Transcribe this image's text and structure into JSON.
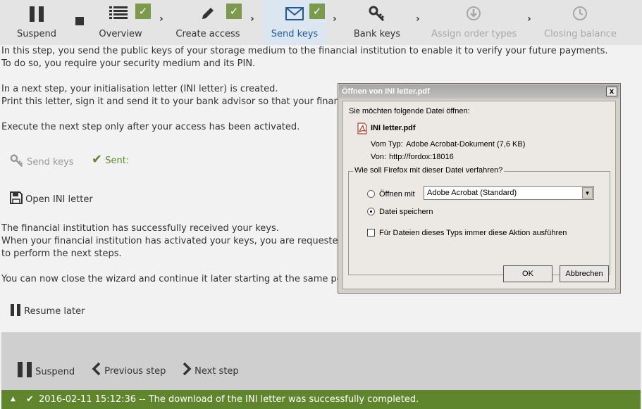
{
  "steps": [
    {
      "key": "suspend",
      "label": "Suspend",
      "icon": "pause-icon",
      "state": "normal"
    },
    {
      "key": "overview",
      "label": "Overview",
      "icon": "list-icon",
      "state": "done"
    },
    {
      "key": "create_access",
      "label": "Create access",
      "icon": "pencil-icon",
      "state": "done"
    },
    {
      "key": "send_keys",
      "label": "Send keys",
      "icon": "envelope-icon",
      "state": "active"
    },
    {
      "key": "bank_keys",
      "label": "Bank keys",
      "icon": "key-icon",
      "state": "normal"
    },
    {
      "key": "assign_order_types",
      "label": "Assign order types",
      "icon": "download-circle-icon",
      "state": "disabled"
    },
    {
      "key": "closing_balance",
      "label": "Closing balance",
      "icon": "clock-icon",
      "state": "disabled"
    }
  ],
  "content": {
    "intro_line1": "In this step, you send the public keys of your storage medium to the financial institution to enable it to verify your future payments.",
    "intro_line2": "To do so, you require your security medium and its PIN.",
    "ini_line1": "In a next step, your initialisation letter (INI letter) is created.",
    "ini_line2": "Print this letter, sign it and send it to your bank advisor so that your financial instit",
    "execute_line": "Execute the next step only after your access has been activated.",
    "send_keys_button": "Send keys",
    "sent_label": "Sent:",
    "open_ini_button": "Open INI letter",
    "received_line1": "The financial institution has successfully received your keys.",
    "received_line2": "When your financial institution has activated your keys, you are requested on the s",
    "received_line3": "to perform the next steps.",
    "close_line": "You can now close the wizard and continue it later starting at the same position.",
    "resume_later_button": "Resume later"
  },
  "footer": {
    "suspend": "Suspend",
    "previous": "Previous step",
    "next": "Next step"
  },
  "status": {
    "text": "2016-02-11 15:12:36 -- The download of the INI letter was successfully completed."
  },
  "dialog": {
    "title": "Öffnen von INI letter.pdf",
    "close": "x",
    "intro": "Sie möchten folgende Datei öffnen:",
    "filename": "INI letter.pdf",
    "type_label": "Vom Typ:",
    "type_value": "Adobe Acrobat-Dokument (7,6 KB)",
    "from_label": "Von:",
    "from_value": "http://fordox:18016",
    "group_legend": "Wie soll Firefox mit dieser Datei verfahren?",
    "open_with_label": "Öffnen mit",
    "open_with_value": "Adobe Acrobat  (Standard)",
    "save_label": "Datei speichern",
    "always_label": "Für Dateien dieses Typs immer diese Aktion ausführen",
    "ok": "OK",
    "cancel": "Abbrechen"
  },
  "colors": {
    "check_green": "#7c9b4a",
    "status_green": "#5f862c",
    "active_blue": "#1f5a9a"
  }
}
